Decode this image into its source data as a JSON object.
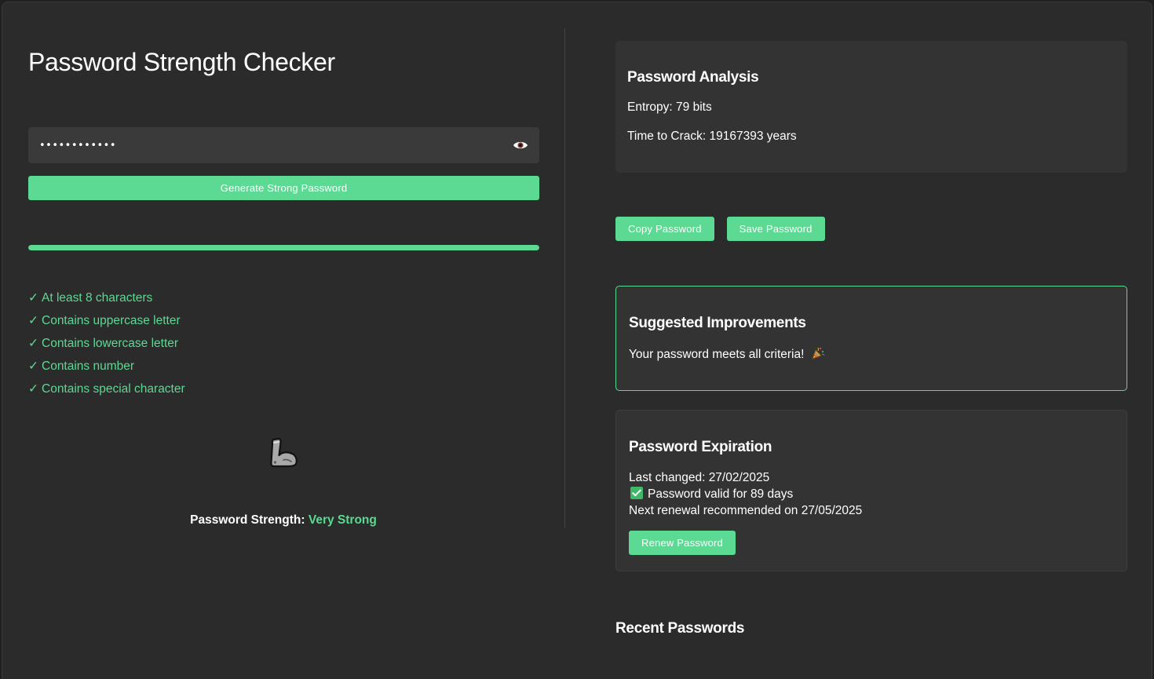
{
  "title": "Password Strength Checker",
  "password_field": {
    "value": "••••••••••••",
    "icon": "eye-icon"
  },
  "generate_button": "Generate Strong Password",
  "strength_meter": {
    "level": 1.0,
    "color": "#5cd992"
  },
  "criteria": [
    {
      "check": "✓",
      "label": "At least 8 characters"
    },
    {
      "check": "✓",
      "label": "Contains uppercase letter"
    },
    {
      "check": "✓",
      "label": "Contains lowercase letter"
    },
    {
      "check": "✓",
      "label": "Contains number"
    },
    {
      "check": "✓",
      "label": "Contains special character"
    }
  ],
  "strength_icon": "flexed-biceps-icon",
  "strength": {
    "label": "Password Strength:",
    "value": "Very Strong"
  },
  "analysis": {
    "title": "Password Analysis",
    "entropy": "Entropy: 79 bits",
    "time_to_crack": "Time to Crack: 19167393 years"
  },
  "actions": {
    "copy": "Copy Password",
    "save": "Save Password"
  },
  "improvements": {
    "title": "Suggested Improvements",
    "message": "Your password meets all criteria!",
    "icon": "party-popper-icon"
  },
  "expiration": {
    "title": "Password Expiration",
    "last_changed": "Last changed: 27/02/2025",
    "valid": "Password valid for 89 days",
    "next_renewal": "Next renewal recommended on 27/05/2025",
    "renew_button": "Renew Password"
  },
  "recent_title": "Recent Passwords",
  "colors": {
    "accent": "#5cd992",
    "background": "#2b2b2b",
    "card": "#333333"
  }
}
